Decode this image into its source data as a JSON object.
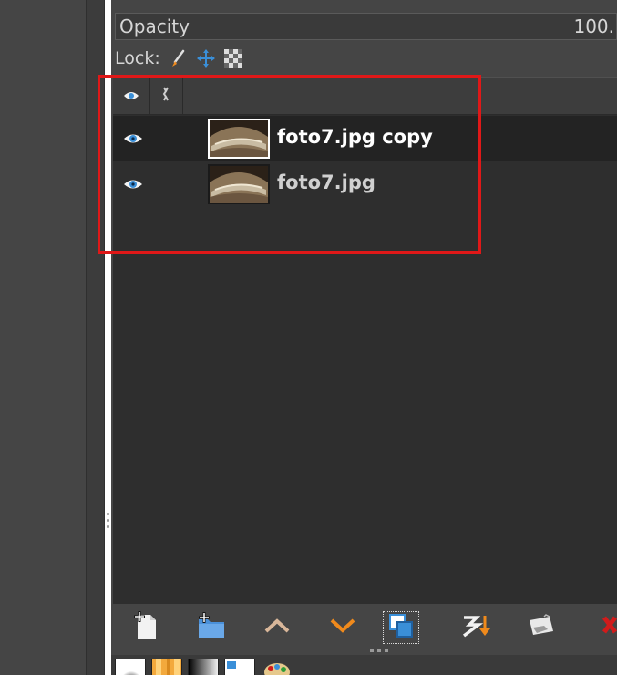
{
  "opacity": {
    "label": "Opacity",
    "value": "100."
  },
  "lock": {
    "label": "Lock:",
    "icons": [
      "paintbrush-icon",
      "move-crosshair-icon",
      "alpha-checker-icon"
    ]
  },
  "list_header": {
    "columns": [
      "eye-icon",
      "chain-link-icon"
    ]
  },
  "layers": [
    {
      "name": "foto7.jpg copy",
      "visible": true,
      "selected": true
    },
    {
      "name": "foto7.jpg",
      "visible": true,
      "selected": false
    }
  ],
  "toolbar": {
    "buttons": [
      "new-layer-icon",
      "new-layer-group-icon",
      "raise-layer-icon",
      "lower-layer-icon",
      "duplicate-layer-icon",
      "merge-down-icon",
      "anchor-layer-icon",
      "delete-layer-icon"
    ]
  },
  "tabs": [
    "brush-tab",
    "pattern-tab",
    "gradient-tab",
    "document-tab",
    "palette-tab"
  ],
  "colors": {
    "highlight": "#e01818",
    "accent_orange": "#f08a1c",
    "accent_blue": "#3a8fd8"
  }
}
